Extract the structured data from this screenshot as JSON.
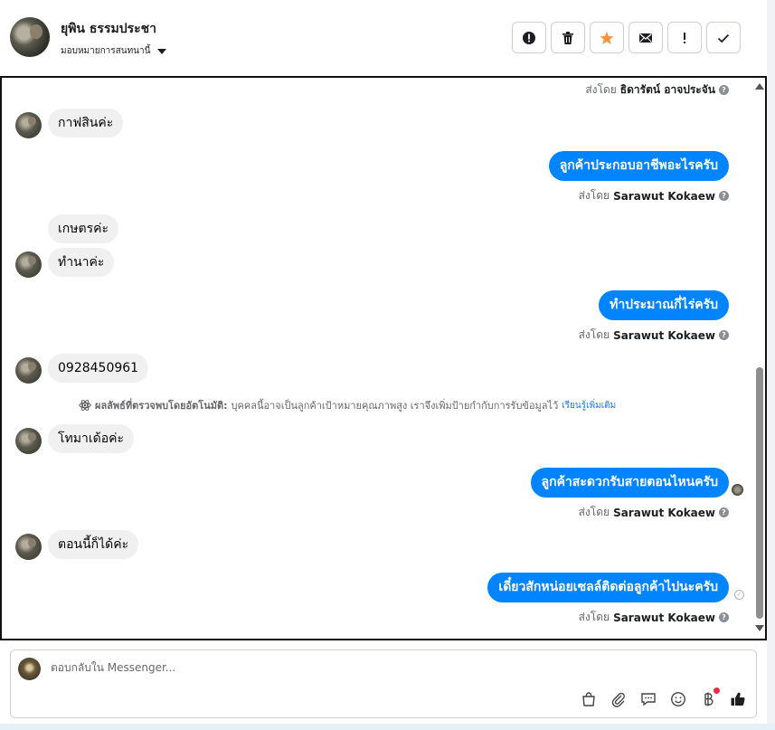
{
  "header": {
    "contact_name": "ยุพิน ธรรมประชา",
    "assign_label": "มอบหมายการสนทนานี้",
    "toolbar_icons": [
      "alert-circle-icon",
      "trash-icon",
      "star-icon",
      "mail-icon",
      "exclamation-icon",
      "check-icon"
    ]
  },
  "thread": {
    "top_sentby": {
      "prefix": "ส่งโดย",
      "name": "ธิดารัตน์ อาจประจัน"
    },
    "messages": [
      {
        "dir": "in",
        "text": "กาฟสินค่ะ"
      },
      {
        "dir": "out",
        "text": "ลูกค้าประกอบอาชีพอะไรครับ",
        "prefix": "ส่งโดย",
        "sender": "Sarawut Kokaew"
      },
      {
        "dir": "in",
        "text": "เกษตรค่ะ"
      },
      {
        "dir": "in",
        "text": "ทำนาค่ะ"
      },
      {
        "dir": "out",
        "text": "ทำประมาณกี่ไร่ครับ",
        "prefix": "ส่งโดย",
        "sender": "Sarawut Kokaew"
      },
      {
        "dir": "in",
        "text": "0928450961"
      },
      {
        "dir": "in",
        "text": "โทมาเด้อค่ะ"
      },
      {
        "dir": "out",
        "text": "ลูกค้าสะดวกรับสายตอนไหนครับ",
        "prefix": "ส่งโดย",
        "sender": "Sarawut Kokaew"
      },
      {
        "dir": "in",
        "text": "ตอนนี้ก็ได้ค่ะ"
      },
      {
        "dir": "out",
        "text": "เดี๋ยวสักหน่อยเซลล์ติดต่อลูกค้าไปนะครับ",
        "prefix": "ส่งโดย",
        "sender": "Sarawut Kokaew"
      }
    ],
    "ai_note": {
      "label": "ผลลัพธ์ที่ตรวจพบโดยอัตโนมัติ:",
      "text": "บุคคลนี้อาจเป็นลูกค้าเป้าหมายคุณภาพสูง เราจึงเพิ่มป้ายกำกับการรับข้อมูลไว้",
      "link": "เรียนรู้เพิ่มเติม"
    }
  },
  "composer": {
    "placeholder": "ตอบกลับใน Messenger...",
    "tools": [
      "bag-icon",
      "paperclip-icon",
      "chat-bubble-icon",
      "emoji-icon",
      "baht-icon",
      "thumbs-up-icon"
    ]
  },
  "colors": {
    "accent": "#0084ff",
    "star": "#f7923b",
    "badge": "#f02849"
  }
}
